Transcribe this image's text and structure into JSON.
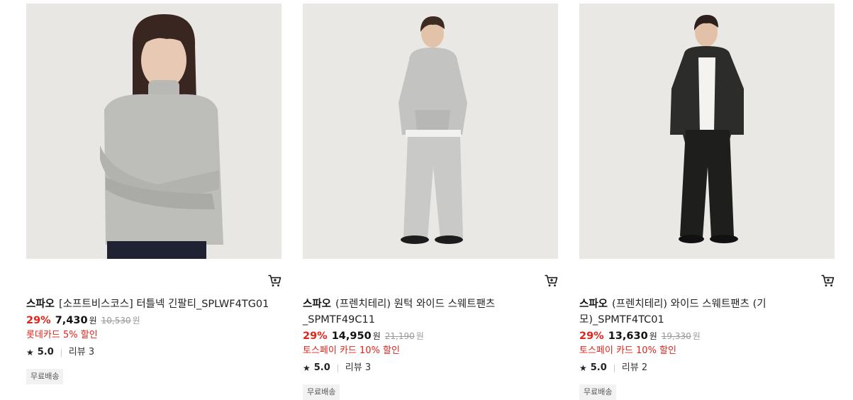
{
  "products": [
    {
      "brand": "스파오",
      "name": "[소프트비스코스] 터틀넥 긴팔티_SPLWF4TG01",
      "discount": "29%",
      "price": "7,430",
      "currency": "원",
      "original_price": "10,530",
      "promo": "롯데카드 5% 할인",
      "rating": "5.0",
      "reviews": "리뷰 3",
      "badge": "무료배송",
      "cart_icon": "cart-icon"
    },
    {
      "brand": "스파오",
      "name": "(프렌치테리) 원턱 와이드 스웨트팬츠_SPMTF49C11",
      "discount": "29%",
      "price": "14,950",
      "currency": "원",
      "original_price": "21,190",
      "promo": "토스페이 카드 10% 할인",
      "rating": "5.0",
      "reviews": "리뷰 3",
      "badge": "무료배송",
      "cart_icon": "cart-icon"
    },
    {
      "brand": "스파오",
      "name": "(프렌치테리) 와이드 스웨트팬츠 (기모)_SPMTF4TC01",
      "discount": "29%",
      "price": "13,630",
      "currency": "원",
      "original_price": "19,330",
      "promo": "토스페이 카드 10% 할인",
      "rating": "5.0",
      "reviews": "리뷰 2",
      "badge": "무료배송",
      "cart_icon": "cart-icon"
    }
  ],
  "colors": {
    "discount": "#e2231a",
    "promo": "#e2231a",
    "image_bg": "#e7e6e3"
  }
}
